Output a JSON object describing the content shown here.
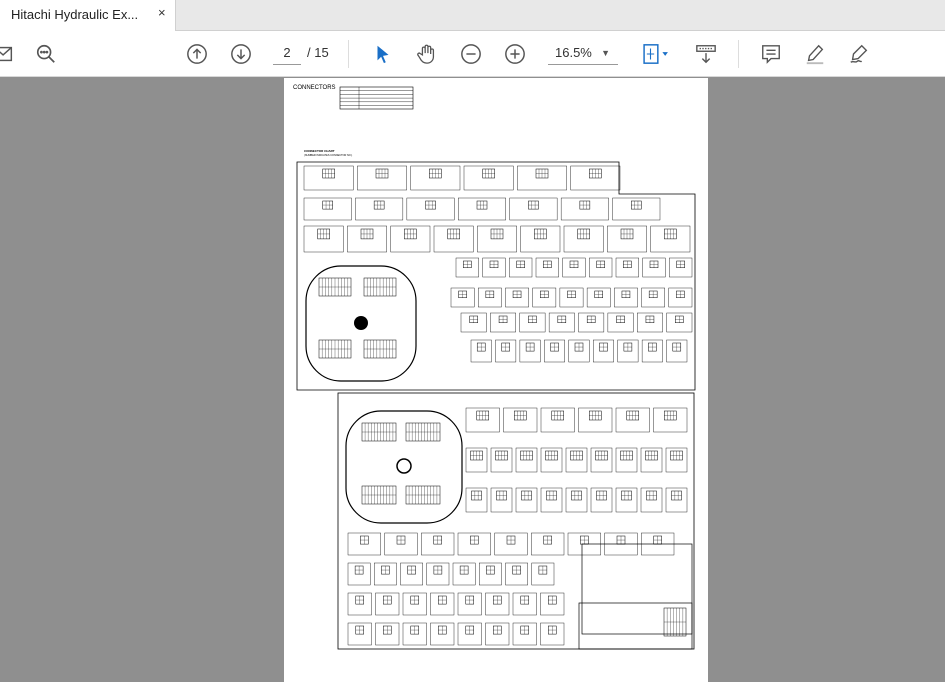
{
  "tab": {
    "title": "Hitachi Hydraulic Ex...",
    "close": "×"
  },
  "toolbar": {
    "current_page": "2",
    "page_total": "/ 15",
    "zoom": "16.5%"
  },
  "document": {
    "title": "CONNECTORS",
    "chart_label": "CONNECTOR CHART",
    "chart_sub": "(NUMBER INDICATES CONNECTOR NO.)"
  }
}
